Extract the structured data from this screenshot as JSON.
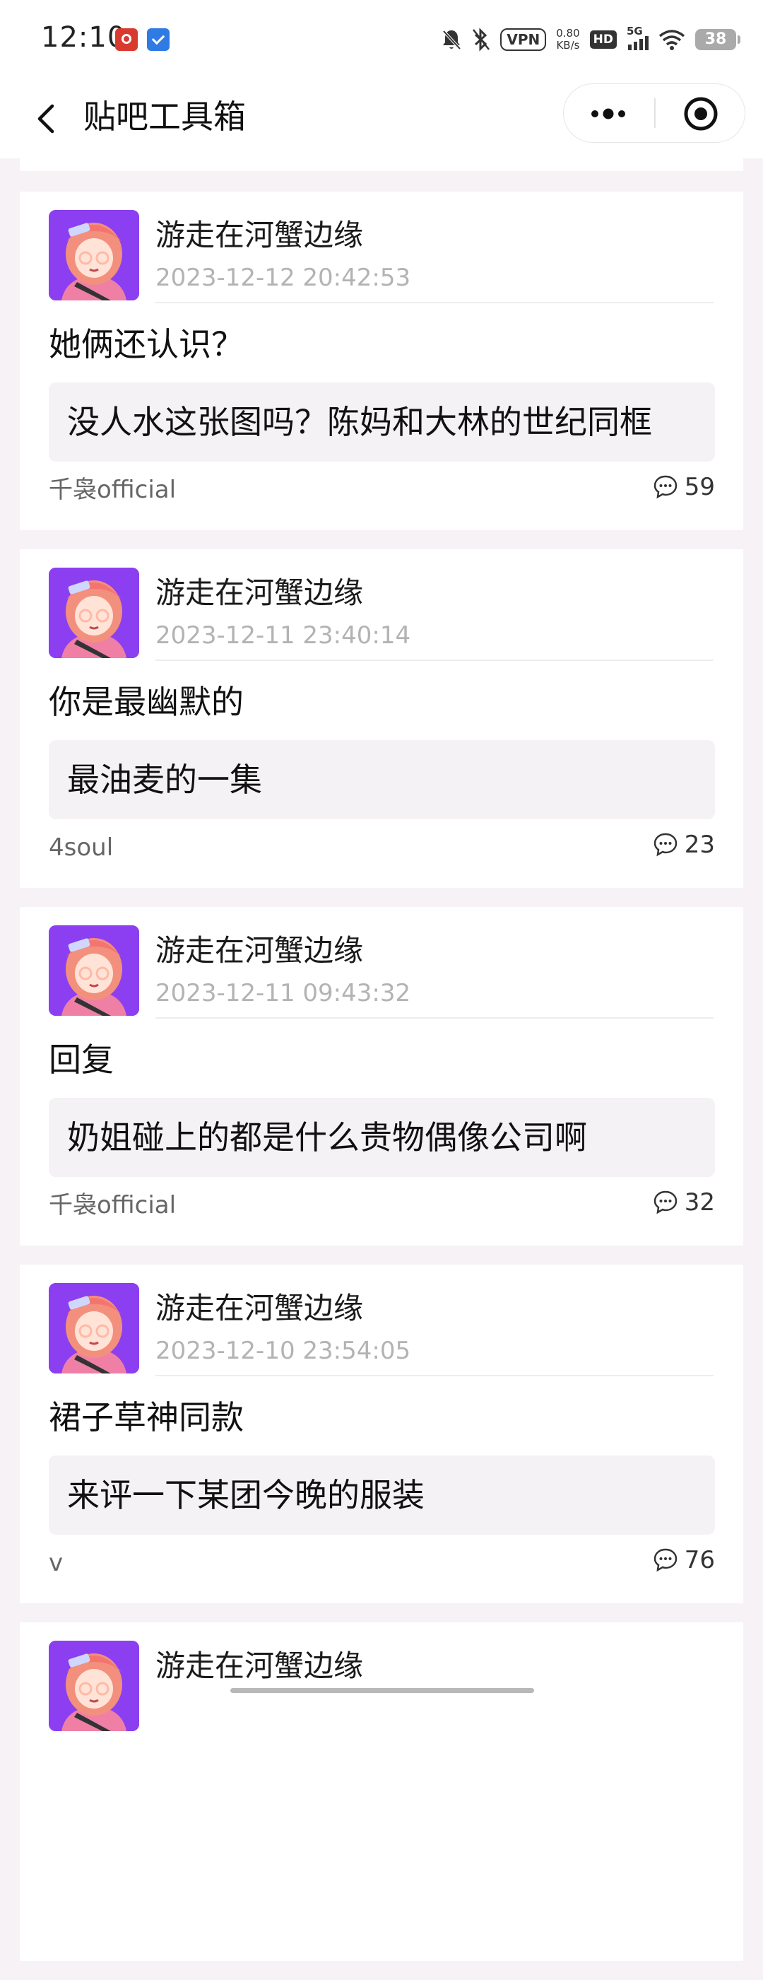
{
  "status_bar": {
    "time": "12:10",
    "vpn": "VPN",
    "speed_value": "0.80",
    "speed_unit": "KB/s",
    "hd": "HD",
    "network": "5G",
    "battery": "38"
  },
  "nav": {
    "title": "贴吧工具箱"
  },
  "posts": [
    {
      "author": "游走在河蟹边缘",
      "time": "2023-12-12 20:42:53",
      "reply": "她俩还认识？",
      "quote": "没人水这张图吗？陈妈和大林的世纪同框",
      "source": "千袅official",
      "comments": "59"
    },
    {
      "author": "游走在河蟹边缘",
      "time": "2023-12-11 23:40:14",
      "reply": "你是最幽默的",
      "quote": "最油麦的一集",
      "source": "4soul",
      "comments": "23"
    },
    {
      "author": "游走在河蟹边缘",
      "time": "2023-12-11 09:43:32",
      "reply": "回复",
      "quote": "奶姐碰上的都是什么贵物偶像公司啊",
      "source": "千袅official",
      "comments": "32"
    },
    {
      "author": "游走在河蟹边缘",
      "time": "2023-12-10 23:54:05",
      "reply": "裙子草神同款",
      "quote": "来评一下某团今晚的服装",
      "source": "v",
      "comments": "76"
    },
    {
      "author": "游走在河蟹边缘"
    }
  ],
  "colors": {
    "page_background": "#f7f2f6",
    "card_background": "#ffffff",
    "quote_background": "#f5f2f5",
    "avatar_background": "#8b3ff0",
    "timestamp_gray": "#b3b3b3"
  },
  "icons": {
    "back": "chevron-left-icon",
    "more": "more-dots-icon",
    "close": "target-circle-icon",
    "comment": "comment-bubble-icon"
  }
}
